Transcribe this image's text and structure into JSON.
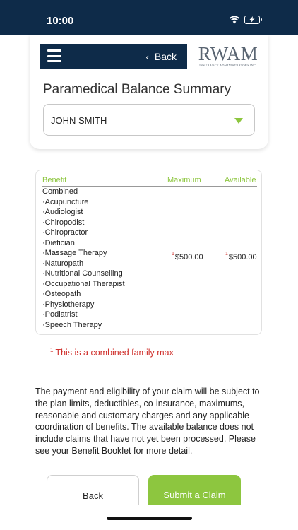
{
  "status_bar": {
    "time": "10:00"
  },
  "nav": {
    "back_label": "Back"
  },
  "logo": {
    "name": "RWAM",
    "tagline": "INSURANCE ADMINISTRATORS INC."
  },
  "page": {
    "title": "Paramedical Balance Summary"
  },
  "member_select": {
    "selected": "JOHN SMITH"
  },
  "table": {
    "headers": {
      "benefit": "Benefit",
      "maximum": "Maximum",
      "available": "Available"
    },
    "benefits": [
      "Combined",
      "·Acupuncture",
      "·Audiologist",
      "·Chiropodist",
      "·Chiropractor",
      "·Dietician",
      "·Massage Therapy",
      "·Naturopath",
      "·Nutritional Counselling",
      "·Occupational Therapist",
      "·Osteopath",
      "·Physiotherapy",
      "·Podiatrist",
      "·Speech Therapy"
    ],
    "maximum": {
      "marker": "1",
      "value": "$500.00"
    },
    "available": {
      "marker": "1",
      "value": "$500.00"
    }
  },
  "footnote": {
    "marker": "1",
    "text": "This is a combined family max"
  },
  "disclaimer": "The payment and eligibility of your claim will be subject to the plan limits, deductibles, co-insurance, maximums, reasonable and customary charges and any applicable coordination of benefits.  The available balance does not include claims that have not yet been processed. Please see your Benefit Booklet for more detail.",
  "buttons": {
    "back": "Back",
    "submit": "Submit a Claim"
  },
  "colors": {
    "navy": "#0e2b49",
    "accent_green": "#8dc63f",
    "footnote_red": "#d0312d"
  }
}
